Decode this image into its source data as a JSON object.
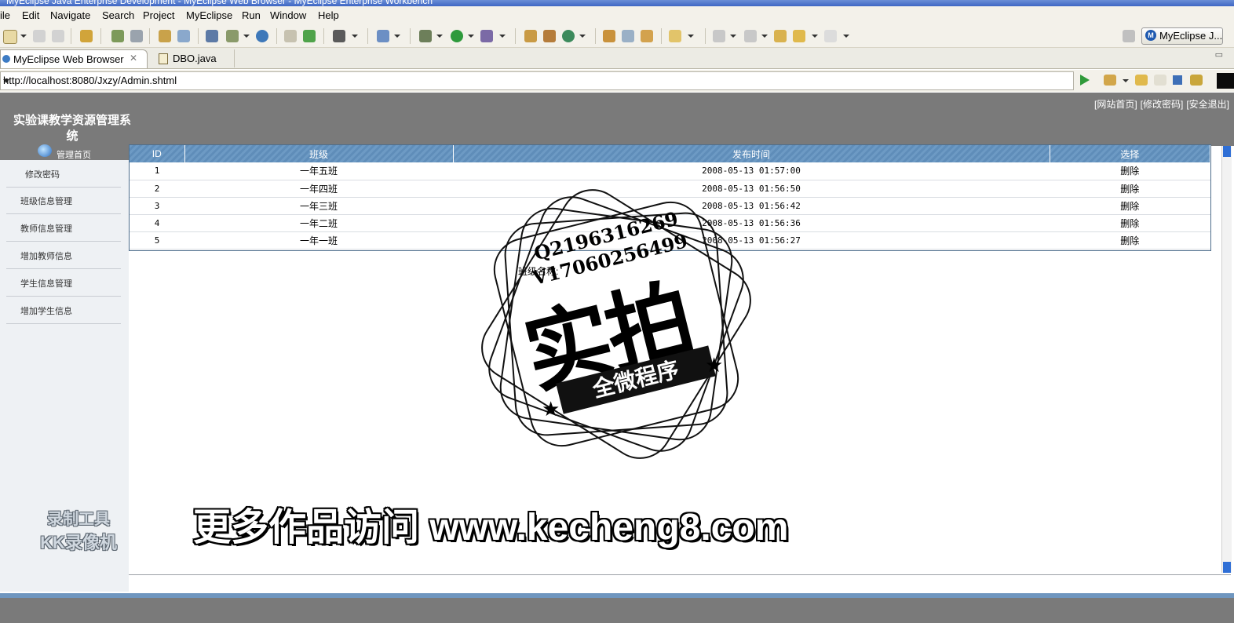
{
  "window": {
    "title": "MyEclipse Java Enterprise Development - MyEclipse Web Browser - MyEclipse Enterprise Workbench"
  },
  "menu": [
    "ile",
    "Edit",
    "Navigate",
    "Search",
    "Project",
    "MyEclipse",
    "Run",
    "Window",
    "Help"
  ],
  "toolbar": {
    "perspective_label": "MyEclipse J..."
  },
  "tabs": [
    {
      "label": "MyEclipse Web Browser",
      "active": true
    },
    {
      "label": "DBO.java",
      "active": false
    }
  ],
  "browser": {
    "url": "http://localhost:8080/Jxzy/Admin.shtml"
  },
  "page": {
    "top_links": [
      "[网站首页]",
      "[修改密码]",
      "[安全退出]"
    ],
    "system_title": "实验课教学资源管理系统",
    "admin_home": "管理首页",
    "nav": [
      "修改密码",
      "班级信息管理",
      "教师信息管理",
      "增加教师信息",
      "学生信息管理",
      "增加学生信息"
    ],
    "table": {
      "headers": [
        "ID",
        "班级",
        "发布时间",
        "选择"
      ],
      "rows": [
        {
          "id": "1",
          "class": "一年五班",
          "time": "2008-05-13 01:57:00",
          "action": "删除"
        },
        {
          "id": "2",
          "class": "一年四班",
          "time": "2008-05-13 01:56:50",
          "action": "删除"
        },
        {
          "id": "3",
          "class": "一年三班",
          "time": "2008-05-13 01:56:42",
          "action": "删除"
        },
        {
          "id": "4",
          "class": "一年二班",
          "time": "2008-05-13 01:56:36",
          "action": "删除"
        },
        {
          "id": "5",
          "class": "一年一班",
          "time": "2008-05-13 01:56:27",
          "action": "删除"
        }
      ]
    },
    "class_name_label": "班级名称:"
  },
  "watermarks": {
    "stamp_line1": "Q2196316269",
    "stamp_line2": "V17060256499",
    "stamp_big": "实拍",
    "stamp_ribbon": "全微程序",
    "promo": "更多作品访问 www.kecheng8.com",
    "recorder_line1": "录制工具",
    "recorder_line2": "KK录像机"
  },
  "colors": {
    "header_gray": "#7a7a7a",
    "table_header_blue": "#6d9ac4",
    "sidebar_bg": "#eef1f4"
  }
}
